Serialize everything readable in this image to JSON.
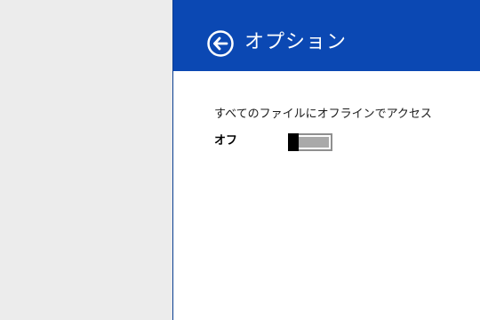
{
  "flyout": {
    "title": "オプション",
    "back_icon": "back-arrow-circle-icon",
    "header_color": "#0b48b3"
  },
  "setting": {
    "label": "すべてのファイルにオフラインでアクセス",
    "state_text": "オフ",
    "is_on": false
  }
}
